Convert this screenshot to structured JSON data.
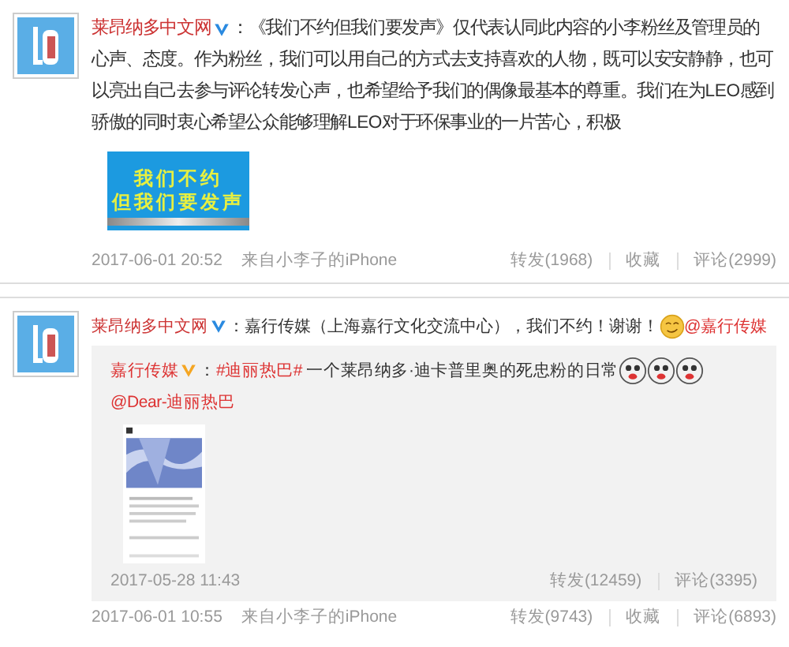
{
  "posts": [
    {
      "author": "莱昂纳多中文网",
      "verified": true,
      "content": [
        {
          "kind": "text",
          "text": "：《我们不约但我们要发声》仅代表认同此内容的小李粉丝及管理员的心声、态度。作为粉丝，我们可以用自己的方式去支持喜欢的人物，既可以安安静静，也可以亮出自己去参与评论转发心声，也希望给予我们的偶像最基本的尊重。我们在为LEO感到骄傲的同时衷心希望公众能够理解LEO对于环保事业的一片苦心，积极"
        }
      ],
      "banner": {
        "lines": [
          "我们不约",
          "但我们要发声"
        ]
      },
      "time": "2017-06-01 20:52",
      "source": "来自小李子的iPhone",
      "actions": [
        "转发(1968)",
        "收藏",
        "评论(2999)"
      ]
    },
    {
      "author": "莱昂纳多中文网",
      "verified": true,
      "content": [
        {
          "kind": "text",
          "text": "：嘉行传媒（上海嘉行文化交流中心），我们不约！谢谢！"
        },
        {
          "kind": "emoji"
        },
        {
          "kind": "mention",
          "text": "@嘉行传媒"
        }
      ],
      "repost": {
        "author": "嘉行传媒",
        "verified": true,
        "content": [
          {
            "kind": "text",
            "text": "："
          },
          {
            "kind": "hashtag",
            "text": "#迪丽热巴#"
          },
          {
            "kind": "text",
            "text": " 一个莱昂纳多·迪卡普里奥的死忠粉的日常"
          },
          {
            "kind": "emoji"
          },
          {
            "kind": "emoji"
          },
          {
            "kind": "emoji"
          },
          {
            "kind": "mention",
            "text": "@Dear-迪丽热巴"
          }
        ],
        "media": {
          "kind": "picture"
        },
        "time": "2017-05-28 11:43",
        "actions": [
          "转发(12459)",
          "评论(3395)"
        ]
      },
      "time": "2017-06-01 10:55",
      "source": "来自小李子的iPhone",
      "actions": [
        "转发(9743)",
        "收藏",
        "评论(6893)"
      ]
    }
  ]
}
